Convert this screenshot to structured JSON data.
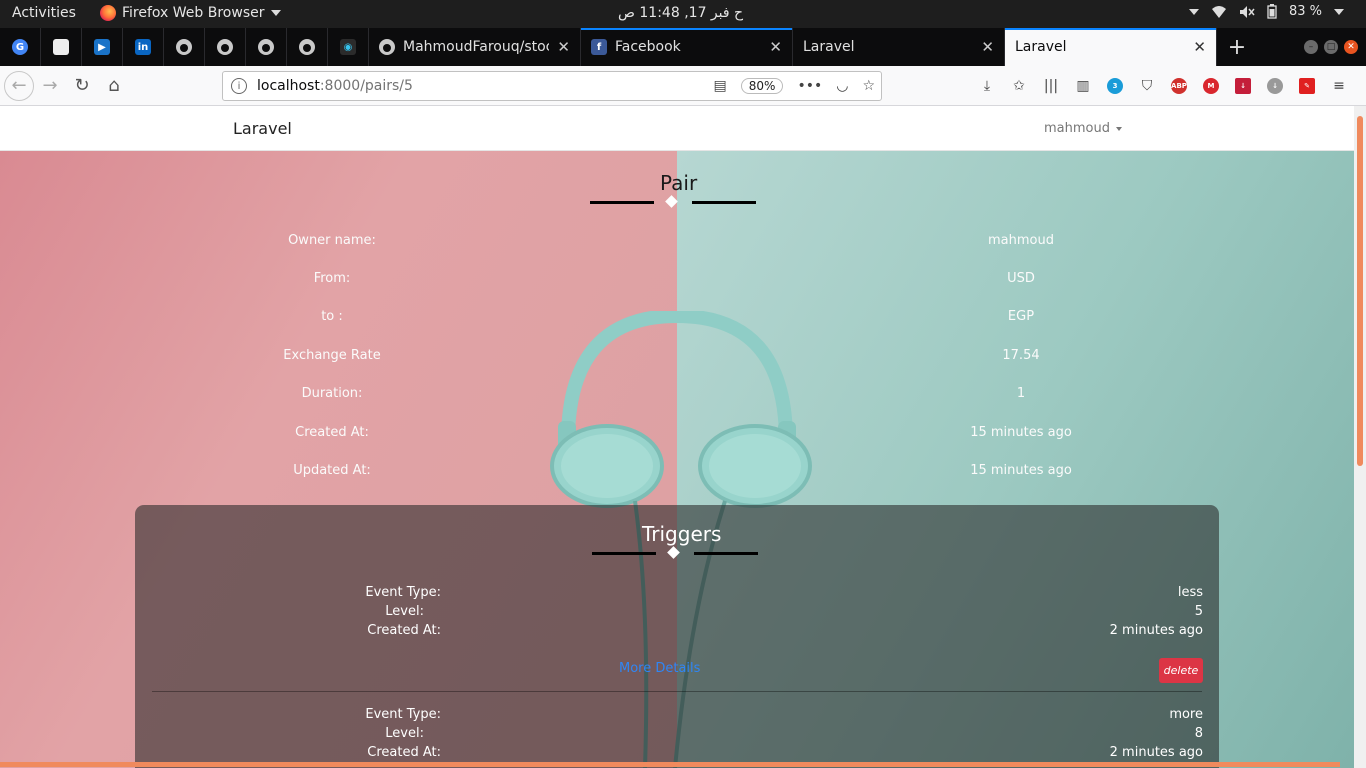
{
  "system": {
    "activities": "Activities",
    "app_name": "Firefox Web Browser",
    "clock": "ح فبر 17, 11:48 ص",
    "battery": "83 %"
  },
  "tabs": [
    {
      "label": "MahmoudFarouq/stock",
      "close": "✕"
    },
    {
      "label": "Facebook",
      "close": "✕"
    },
    {
      "label": "Laravel",
      "close": "✕"
    },
    {
      "label": "Laravel",
      "close": "✕"
    }
  ],
  "navbar": {
    "url_host": "localhost",
    "url_path": ":8000/pairs/5",
    "zoom": "80%",
    "ext_badge": "3",
    "abp": "ABP"
  },
  "app": {
    "brand": "Laravel",
    "user": "mahmoud"
  },
  "pair": {
    "title": "Pair",
    "fields": [
      {
        "label": "Owner name:",
        "value": "mahmoud"
      },
      {
        "label": "From:",
        "value": "USD"
      },
      {
        "label": "to :",
        "value": "EGP"
      },
      {
        "label": "Exchange Rate",
        "value": "17.54"
      },
      {
        "label": "Duration:",
        "value": "1"
      },
      {
        "label": "Created At:",
        "value": "15 minutes ago"
      },
      {
        "label": "Updated At:",
        "value": "15 minutes ago"
      }
    ]
  },
  "triggers": {
    "title": "Triggers",
    "more_details": "More Details",
    "delete": "delete",
    "items": [
      {
        "event_type_label": "Event Type:",
        "event_type": "less",
        "level_label": "Level:",
        "level": "5",
        "created_label": "Created At:",
        "created": "2 minutes ago"
      },
      {
        "event_type_label": "Event Type:",
        "event_type": "more",
        "level_label": "Level:",
        "level": "8",
        "created_label": "Created At:",
        "created": "2 minutes ago"
      }
    ]
  },
  "colors": {
    "accent": "#0a84ff",
    "delete": "#dc3545",
    "link": "#2f86f5",
    "scroll": "#f08a5d"
  }
}
